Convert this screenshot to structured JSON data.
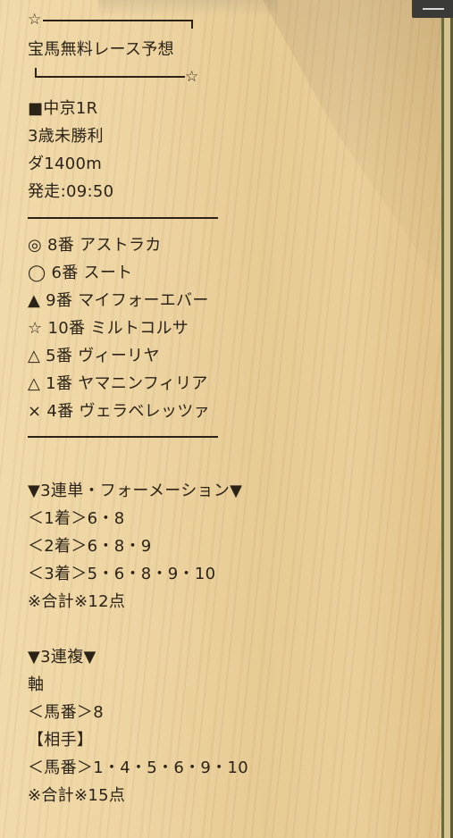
{
  "header": {
    "star_left": "☆",
    "title": "宝馬無料レース予想",
    "star_right": "☆"
  },
  "race": {
    "name": "■中京1R",
    "class": "3歳未勝利",
    "distance": "ダ1400m",
    "start": "発走:09:50"
  },
  "picks": [
    "◎ 8番 アストラカ",
    "◯ 6番 スート",
    "▲ 9番 マイフォーエバー",
    "☆ 10番 ミルトコルサ",
    "△ 5番 ヴィーリヤ",
    "△ 1番 ヤマニンフィリア",
    "× 4番 ヴェラベレッツァ"
  ],
  "trifecta": {
    "heading": "▼3連単・フォーメーション▼",
    "first": "＜1着＞6・8",
    "second": "＜2着＞6・8・9",
    "third": "＜3着＞5・6・8・9・10",
    "total": "※合計※12点"
  },
  "trio": {
    "heading": "▼3連複▼",
    "axis_label": "軸",
    "axis": "＜馬番＞8",
    "partner_label": "【相手】",
    "partners": "＜馬番＞1・4・5・6・9・10",
    "total": "※合計※15点"
  },
  "menu": {
    "icon": "hamburger-menu-icon"
  }
}
